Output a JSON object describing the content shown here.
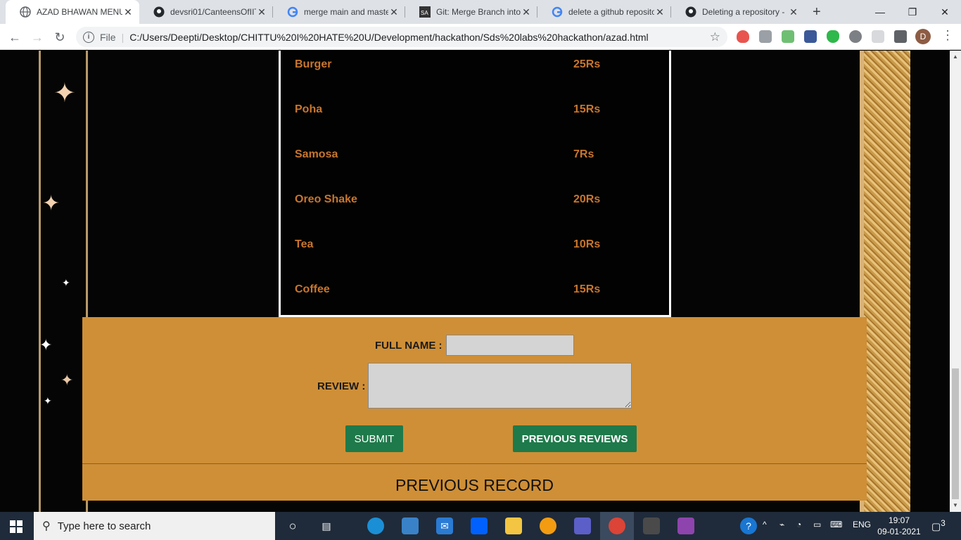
{
  "browser": {
    "tabs": [
      {
        "title": "AZAD BHAWAN MENU",
        "icon": "globe-icon"
      },
      {
        "title": "devsri01/CanteensOfIIT",
        "icon": "github-icon"
      },
      {
        "title": "merge main and maste",
        "icon": "google-icon"
      },
      {
        "title": "Git: Merge Branch into",
        "icon": "sa-icon"
      },
      {
        "title": "delete a github reposito",
        "icon": "google-icon"
      },
      {
        "title": "Deleting a repository -",
        "icon": "github-icon"
      }
    ],
    "close_glyph": "✕",
    "new_tab_glyph": "+",
    "window_controls": {
      "minimize": "—",
      "maximize": "❐",
      "close": "✕"
    },
    "nav": {
      "back": "←",
      "forward": "→",
      "reload": "↻"
    },
    "address": {
      "scheme_label": "File",
      "url": "C:/Users/Deepti/Desktop/CHITTU%20I%20HATE%20U/Development/hackathon/Sds%20labs%20hackathon/azad.html"
    },
    "profile_initial": "D"
  },
  "menu": {
    "items": [
      {
        "name": "Burger",
        "price": "25Rs"
      },
      {
        "name": "Poha",
        "price": "15Rs"
      },
      {
        "name": "Samosa",
        "price": "7Rs"
      },
      {
        "name": "Oreo Shake",
        "price": "20Rs"
      },
      {
        "name": "Tea",
        "price": "10Rs"
      },
      {
        "name": "Coffee",
        "price": "15Rs"
      }
    ]
  },
  "form": {
    "fullname_label": "FULL NAME :",
    "fullname_value": "",
    "review_label": "REVIEW :",
    "review_value": "",
    "submit_label": "SUBMIT",
    "previous_reviews_label": "PREVIOUS REVIEWS"
  },
  "previous_record_heading": "PREVIOUS RECORD",
  "taskbar": {
    "search_placeholder": "Type here to search",
    "language": "ENG",
    "time": "19:07",
    "date": "09-01-2021",
    "notification_count": "3"
  },
  "colors": {
    "menu_text": "#c8762e",
    "form_bg": "#cf8f37",
    "button_bg": "#1e7a4a"
  }
}
